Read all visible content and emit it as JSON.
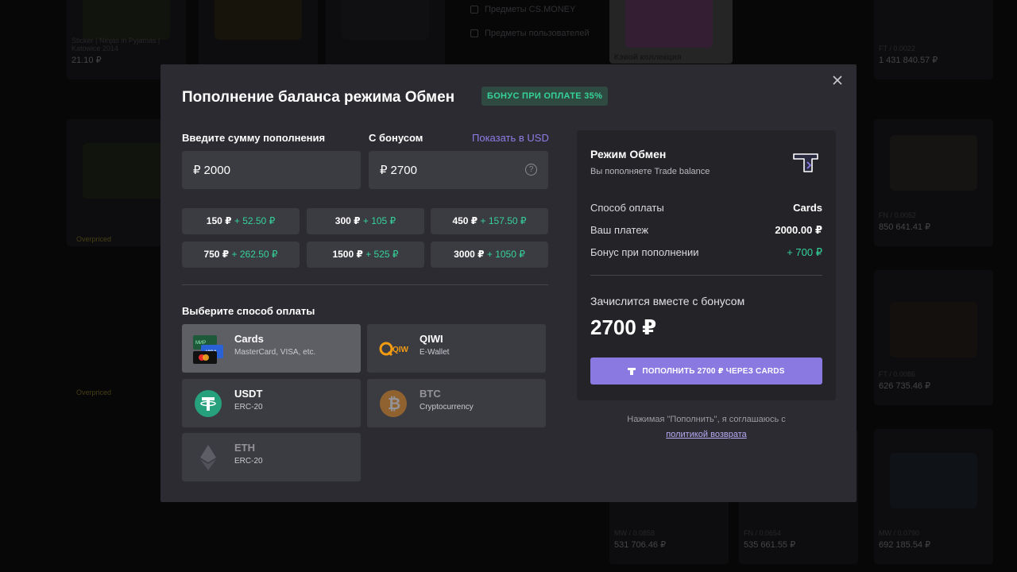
{
  "modal": {
    "title": "Пополнение баланса режима Обмен",
    "bonus_badge": "БОНУС ПРИ ОПЛАТЕ 35%",
    "amount_label": "Введите сумму пополнения",
    "bonus_label": "С бонусом",
    "usd_link": "Показать в USD",
    "amount_currency": "₽",
    "amount_value": "2000",
    "bonus_currency": "₽",
    "bonus_value": "2700",
    "presets": [
      {
        "base": "150 ₽",
        "bonus": "+ 52.50 ₽"
      },
      {
        "base": "300 ₽",
        "bonus": "+ 105 ₽"
      },
      {
        "base": "450 ₽",
        "bonus": "+ 157.50 ₽"
      },
      {
        "base": "750 ₽",
        "bonus": "+ 262.50 ₽"
      },
      {
        "base": "1500 ₽",
        "bonus": "+ 525 ₽"
      },
      {
        "base": "3000 ₽",
        "bonus": "+ 1050 ₽"
      }
    ],
    "method_label": "Выберите способ оплаты",
    "methods": [
      {
        "name": "Cards",
        "desc": "MasterCard, VISA, etc."
      },
      {
        "name": "QIWI",
        "desc": "E-Wallet"
      },
      {
        "name": "USDT",
        "desc": "ERC-20"
      },
      {
        "name": "BTC",
        "desc": "Cryptocurrency"
      },
      {
        "name": "ETH",
        "desc": "ERC-20"
      }
    ],
    "icons": {
      "cards": "credit-cards-icon",
      "qiwi": "qiwi-logo-icon",
      "usdt": "tether-icon",
      "btc": "bitcoin-icon",
      "eth": "ethereum-icon",
      "trade": "trade-balance-icon",
      "close": "close-icon"
    },
    "card_text": {
      "mir": "МИР",
      "visa": "VISA"
    }
  },
  "summary": {
    "title": "Режим Обмен",
    "subtitle": "Вы пополняете Trade balance",
    "rows": [
      {
        "label": "Способ оплаты",
        "value": "Cards"
      },
      {
        "label": "Ваш платеж",
        "value": "2000.00 ₽"
      },
      {
        "label": "Бонус при пополнении",
        "value": "+ 700 ₽"
      }
    ],
    "credit_label": "Зачислится вместе с бонусом",
    "credit_value": "2700 ₽",
    "button_label": "ПОПОЛНИТЬ 2700 ₽ ЧЕРЕЗ CARDS",
    "agree_text": "Нажимая \"Пополнить\", я соглашаюсь с",
    "refund_link": "политикой возврата"
  },
  "background": {
    "filters": [
      "Предметы CS.MONEY",
      "Предметы пользователей"
    ],
    "prices": [
      "21.10 ₽",
      "1 431 840.57 ₽",
      "850 641.41 ₽",
      "626 735.46 ₽",
      "531 706.46 ₽",
      "535 661.55 ₽",
      "692 185.54 ₽"
    ],
    "card_sub": [
      "Sticker | Ninjas in Pyjamas | Katowice 2014",
      "FT / 0.0022",
      "FN / 0.0052",
      "FT / 0.0086",
      "MW / 0.0858",
      "FN / 0.0654",
      "MW / 0.0790"
    ],
    "tag": "Overpriced",
    "partial_title": "Кэвой коллекция"
  },
  "colors": {
    "accent": "#8b79e2",
    "bonus_green": "#35d39a",
    "modal_bg": "#2b2b31"
  }
}
